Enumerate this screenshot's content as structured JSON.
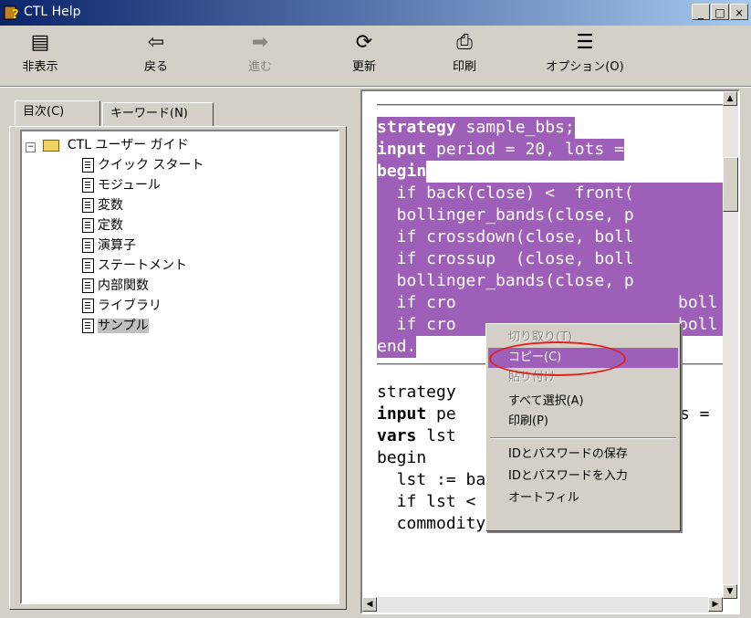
{
  "window": {
    "title": "CTL Help"
  },
  "toolbar": {
    "hide": "非表示",
    "back": "戻る",
    "forward": "進む",
    "refresh": "更新",
    "print": "印刷",
    "options": "オプション(O)"
  },
  "tabs": {
    "contents": "目次(C)",
    "keyword": "キーワード(N)"
  },
  "tree": {
    "root": "CTL ユーザー ガイド",
    "items": [
      "クイック スタート",
      "モジュール",
      "変数",
      "定数",
      "演算子",
      "ステートメント",
      "内部関数",
      "ライブラリ",
      "サンプル"
    ]
  },
  "code1": [
    {
      "k": "strategy",
      "r": " sample_bbs;"
    },
    {
      "k": "input",
      "r": " period = 20, lots ="
    },
    {
      "k": "begin",
      "r": ""
    }
  ],
  "code1b": [
    "  if back(close) <  front(",
    "  bollinger_bands(close, p",
    "  if crossdown(close, boll",
    "  if crossup  (close, boll",
    "  bollinger_bands(close, p",
    "  if cro",
    "  if cro"
  ],
  "code1_tail": [
    "boll",
    "boll"
  ],
  "code1_end": "end.",
  "code2": {
    "l1": "strategy",
    "l2k": "input",
    "l2r": " pe",
    "l2tail": "s =",
    "l3k": "vars",
    "l3r": " lst",
    "l4": "begin",
    "l5": "  lst := back(close);",
    "l6": "  if lst <  front(close) -",
    "l7": "  commodity channel(period"
  },
  "menu": {
    "cut": "切り取り(T)",
    "copy": "コピー(C)",
    "paste": "貼り付け",
    "select_all": "すべて選択(A)",
    "print": "印刷(P)",
    "save_id": "IDとパスワードの保存",
    "enter_id": "IDとパスワードを入力",
    "autofill": "オートフィル"
  },
  "colors": {
    "highlight": "#9e5fb8",
    "titlebar": "#0a246a",
    "annotation": "#e02020"
  }
}
